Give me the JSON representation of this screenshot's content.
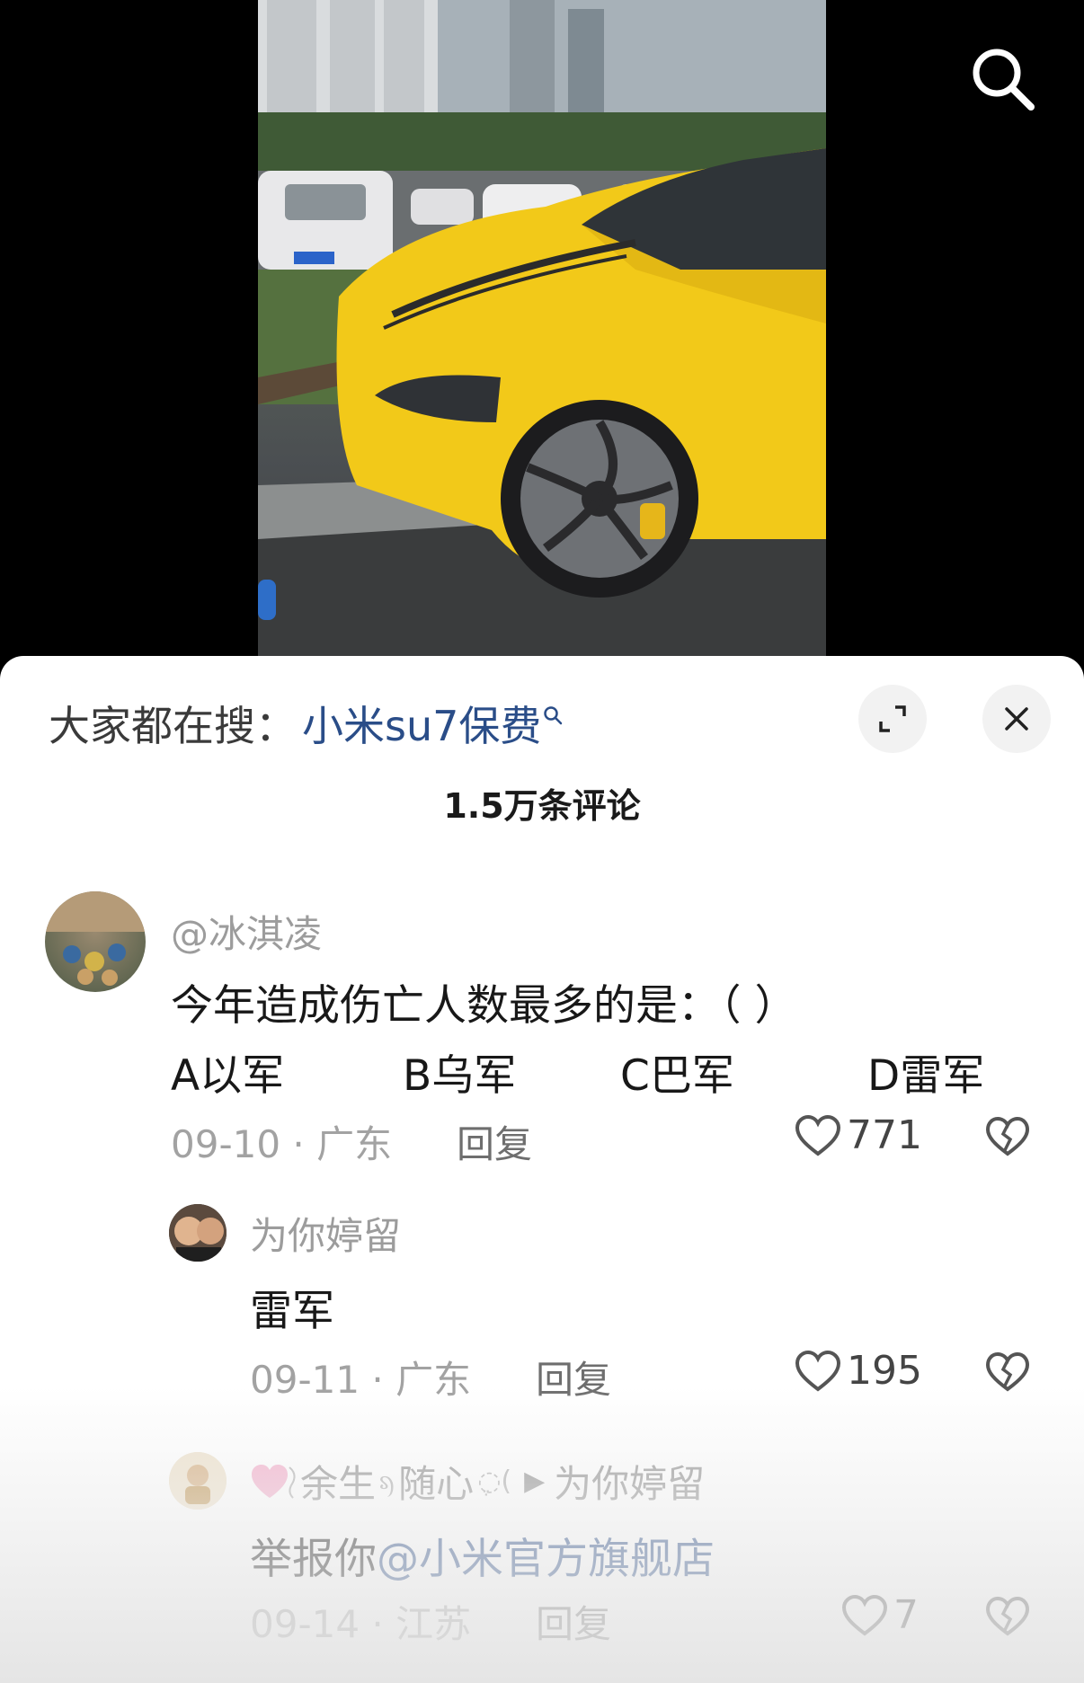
{
  "search_icon": "search-icon",
  "sheet": {
    "trending_label": "大家都在搜：",
    "trending_keyword": "小米su7保费",
    "comment_count": "1.5万条评论"
  },
  "comments": [
    {
      "username": "@冰淇凌",
      "line1": "今年造成伤亡人数最多的是：（         ）",
      "options": [
        "A以军",
        "B乌军",
        "C巴军",
        "D雷军"
      ],
      "date": "09-10 · 广东",
      "reply": "回复",
      "likes": "771"
    },
    {
      "username": "为你婷留",
      "text": "雷军",
      "date": "09-11 · 广东",
      "reply": "回复",
      "likes": "195"
    },
    {
      "username": "余生",
      "username_suffix": "随心",
      "reply_to": "为你婷留",
      "text_prefix": "举报你",
      "mention": "@小米官方旗舰店",
      "date": "09-14 · 江苏",
      "reply": "回复",
      "likes": "7"
    }
  ]
}
